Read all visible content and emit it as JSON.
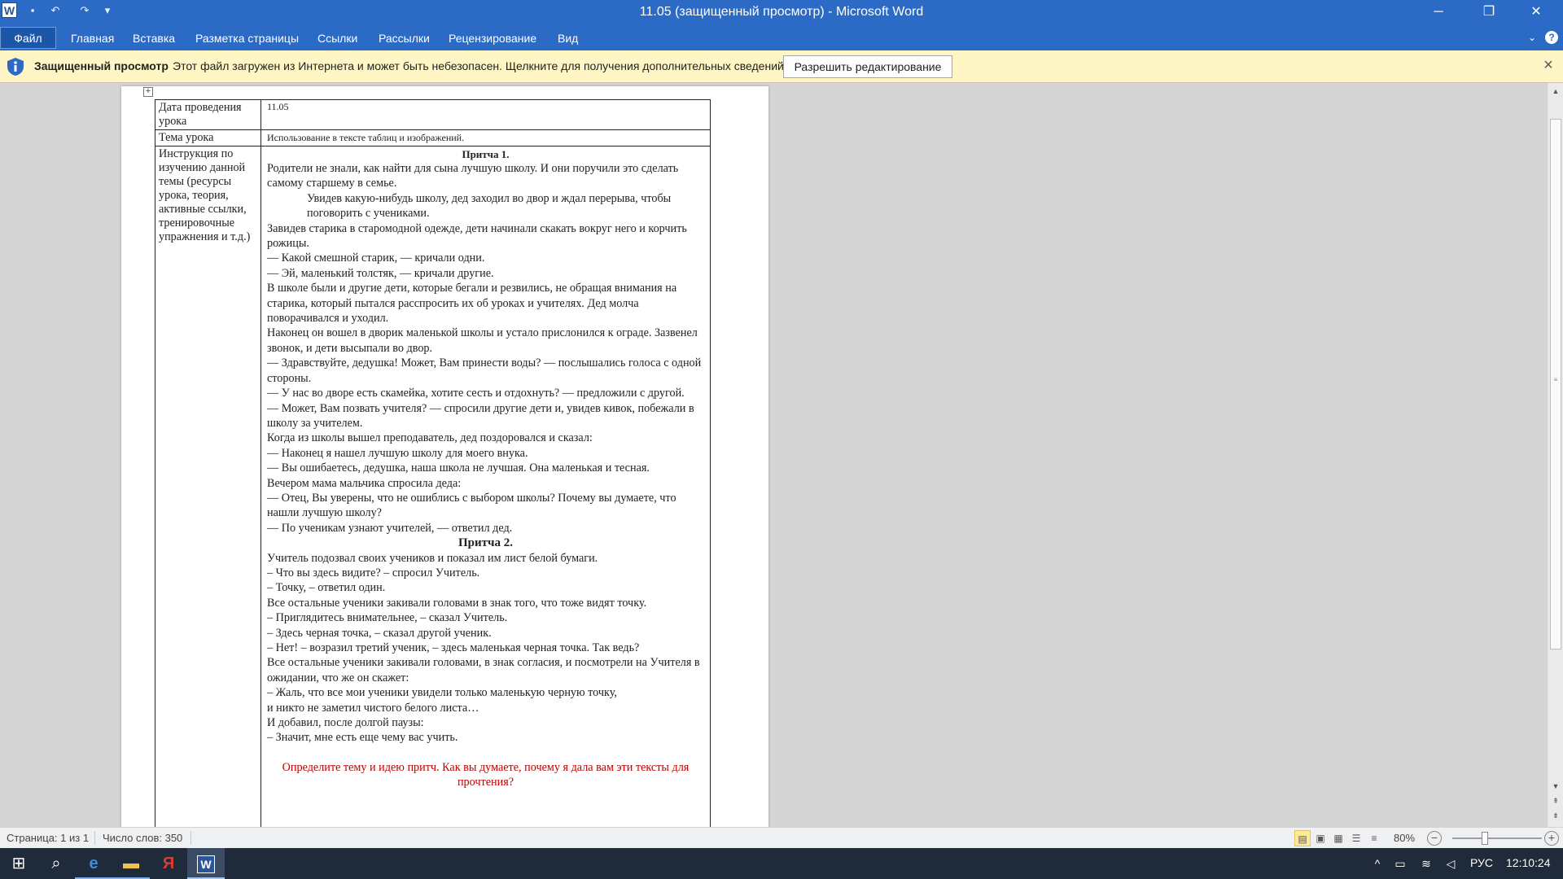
{
  "window": {
    "title": "11.05 (защищенный просмотр)  -  Microsoft Word",
    "app_icon": "W",
    "quick_access": [
      "save-icon",
      "undo-icon",
      "redo-icon",
      "customize-icon"
    ],
    "controls": {
      "minimize": "─",
      "restore": "❐",
      "close": "✕"
    }
  },
  "ribbon": {
    "file_tab": "Файл",
    "tabs": [
      "Главная",
      "Вставка",
      "Разметка страницы",
      "Ссылки",
      "Рассылки",
      "Рецензирование",
      "Вид"
    ],
    "right_icons": [
      "minimize-ribbon-icon",
      "help-icon"
    ]
  },
  "protected_view": {
    "title": "Защищенный просмотр",
    "message": "Этот файл загружен из Интернета и может быть небезопасен. Щелкните для получения дополнительных сведений.",
    "button": "Разрешить редактирование",
    "colors": {
      "background": "#fff6c5",
      "shield": "#2b6bc5"
    }
  },
  "document": {
    "table": {
      "date_label": "Дата проведения урока",
      "date_value": "11.05",
      "topic_label": "Тема урока",
      "topic_value": "Использование в тексте таблиц и изображений.",
      "instructions_label": "Инструкция по изучению данной темы (ресурсы урока, теория, активные ссылки, тренировочные упражнения и т.д.)"
    },
    "parable1_title": "Притча  1.",
    "parable1": [
      "Родители не знали, как найти для сына лучшую школу. И они поручили это сделать самому старшему в семье.",
      "Увидев какую-нибудь школу, дед заходил во двор и ждал перерыва, чтобы поговорить с учениками.",
      "Завидев старика в старомодной одежде, дети начинали скакать вокруг него и корчить рожицы.",
      "— Какой смешной старик, — кричали одни.",
      "— Эй, маленький толстяк, — кричали другие.",
      "В школе были и другие дети, которые  бегали и резвились, не обращая внимания на старика, который пытался расспросить их об уроках и учителях. Дед молча поворачивался и уходил.",
      "Наконец он вошел в дворик маленькой школы и устало прислонился к ограде. Зазвенел звонок, и дети высыпали во двор.",
      "— Здравствуйте, дедушка! Может, Вам принести воды? — послышались голоса с одной стороны.",
      "— У нас во дворе есть скамейка, хотите сесть и отдохнуть? — предложили с другой.",
      "— Может, Вам позвать учителя? — спросили другие дети и, увидев кивок, побежали в школу за учителем.",
      "Когда из школы вышел преподаватель, дед поздоровался и сказал:",
      "— Наконец я нашел лучшую школу для моего внука.",
      "— Вы ошибаетесь, дедушка, наша школа не лучшая. Она маленькая и тесная.",
      "Вечером мама мальчика спросила деда:",
      "— Отец, Вы уверены, что не ошиблись с выбором школы? Почему вы думаете, что нашли лучшую школу?",
      "— По ученикам узнают учителей,  — ответил дед."
    ],
    "parable2_title": "Притча 2.",
    "parable2": [
      "Учитель подозвал своих учеников и показал им лист белой бумаги.",
      "– Что вы здесь видите? – спросил Учитель.",
      "– Точку, – ответил один.",
      "Все остальные ученики закивали головами в знак того, что тоже видят точку.",
      "– Приглядитесь внимательнее, – сказал Учитель.",
      "– Здесь черная точка, – сказал другой ученик.",
      "– Нет! – возразил третий ученик, – здесь маленькая черная точка. Так ведь?",
      "Все остальные ученики закивали головами, в знак согласия, и посмотрели на Учителя в ожидании, что же он скажет:",
      "– Жаль, что все мои ученики увидели только маленькую черную точку,",
      "и никто не заметил чистого белого листа…",
      "И добавил, после долгой паузы:",
      "– Значит, мне есть еще чему вас учить."
    ],
    "task": "Определите тему и идею притч. Как вы думаете, почему я дала вам эти тексты для прочтения?",
    "colors": {
      "task": "#c00000"
    }
  },
  "statusbar": {
    "page": "Страница: 1 из 1",
    "words": "Число слов: 350",
    "zoom": "80%",
    "zoom_level": 0.8,
    "view_buttons": [
      "print-layout-icon",
      "full-screen-reading-icon",
      "web-layout-icon",
      "outline-icon",
      "draft-icon"
    ]
  },
  "taskbar": {
    "icons": [
      "start-icon",
      "search-icon",
      "edge-icon",
      "explorer-icon",
      "yandex-icon",
      "word-icon"
    ],
    "language": "РУС",
    "time": "12:10:24"
  }
}
